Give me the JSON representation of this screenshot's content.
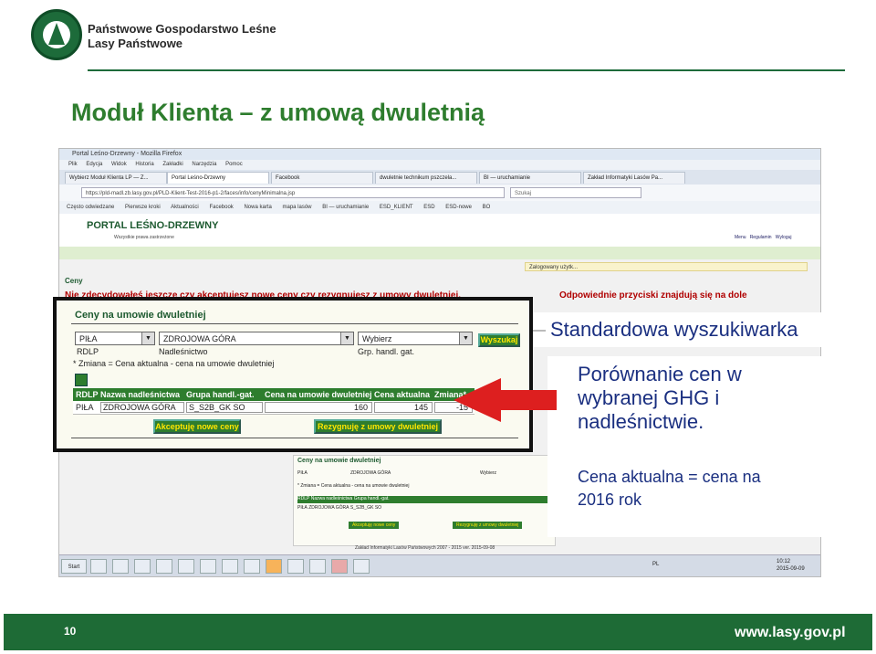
{
  "header": {
    "org_line1": "Państwowe Gospodarstwo Leśne",
    "org_line2": "Lasy Państwowe",
    "slide_title": "Moduł Klienta – z umową dwuletnią"
  },
  "browser": {
    "window_title": "Portal Leśno-Drzewny - Mozilla Firefox",
    "menu": [
      "Plik",
      "Edycja",
      "Widok",
      "Historia",
      "Zakładki",
      "Narzędzia",
      "Pomoc"
    ],
    "tabs": [
      "Wybierz Moduł Klienta LP — Z...",
      "Portal Leśno-Drzewny",
      "Facebook",
      "dwuletnie technikum pszczela...",
      "BI — uruchamianie",
      "Zakład Informatyki Lasów Pa..."
    ],
    "url": "https://pld-madl.zb.lasy.gov.pl/PLD-Klient-Test-2016-p1-2/faces/info/cenyMinimalna.jsp",
    "search_placeholder": "Szukaj",
    "bookmarks": [
      "Często odwiedzane",
      "Pierwsze kroki",
      "Aktualności",
      "Facebook",
      "Nowa karta",
      "mapa lasów",
      "BI — uruchamianie",
      "ESD_KLIENT",
      "ESD",
      "ESD-nowe",
      "BO"
    ]
  },
  "portal": {
    "title": "PORTAL LEŚNO-DRZEWNY",
    "subtitle": "Wszystkie prawa zastrzeżone",
    "links": [
      "Menu",
      "Regulamin",
      "Wyloguj"
    ],
    "logged_in": "Zalogowany użytk...",
    "section": "Ceny",
    "warning_left": "Nie zdecydowałeś jeszcze czy akceptujesz nowe ceny czy rezygnujesz z umowy dwuletniej.",
    "warning_right": "Odpowiednie przyciski znajdują się na dole",
    "footer": "Zakład Informatyki Lasów Państwowych 2007 - 2015 ver. 2015-09-08"
  },
  "panel": {
    "title": "Ceny na umowie dwuletniej",
    "select1": "PIŁA",
    "select2": "ZDROJOWA GÓRA",
    "select3": "Wybierz",
    "search_button": "Wyszukaj",
    "label_rdlp": "RDLP",
    "label_nadl": "Nadleśnictwo",
    "label_grp": "Grp. handl. gat.",
    "note": "* Zmiana = Cena aktualna - cena na umowie dwuletniej",
    "columns": [
      "RDLP",
      "Nazwa nadleśnictwa",
      "Grupa handl.-gat.",
      "Cena na umowie dwuletniej",
      "Cena aktualna",
      "Zmiana*"
    ],
    "row": [
      "PIŁA",
      "ZDROJOWA GÓRA",
      "S_S2B_GK SO",
      "160",
      "145",
      "-15"
    ],
    "accept_button": "Akceptuję nowe ceny",
    "resign_button": "Rezygnuję z umowy dwuletniej"
  },
  "taskbar": {
    "start": "Start",
    "lang": "PL",
    "time": "10:12",
    "date": "2015-09-09"
  },
  "annotations": {
    "standard": "Standardowa wyszukiwarka",
    "compare_lines": [
      "Porównanie cen w",
      "wybranej GHG i",
      "nadleśnictwie."
    ],
    "price_lines": [
      "Cena aktualna = cena na",
      "2016 rok"
    ]
  },
  "footer": {
    "page_number": "10",
    "url": "www.lasy.gov.pl"
  },
  "colors": {
    "brand_green": "#1e6b36",
    "title_green": "#2e7d2e",
    "annotation_blue": "#1a2f80",
    "arrow_red": "#dd1f1f",
    "warning_red": "#b00000"
  }
}
